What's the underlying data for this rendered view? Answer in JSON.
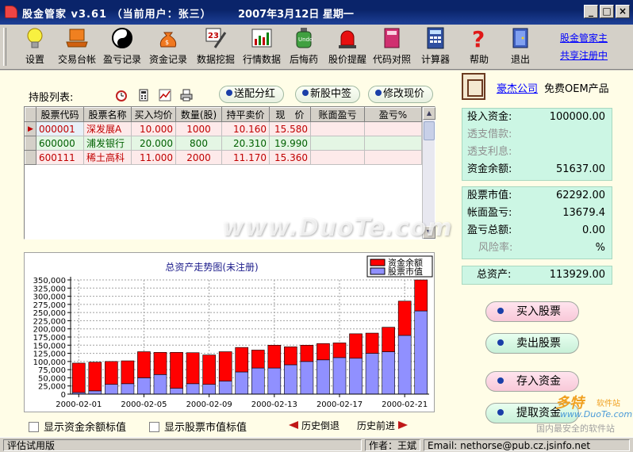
{
  "window": {
    "title": "股金管家 v3.61 （当前用户：张三）",
    "date": "2007年3月12日  星期一",
    "minimize": "_",
    "maximize": "□",
    "close": "×"
  },
  "toolbar": {
    "items": [
      {
        "label": "设置",
        "icon": "lightbulb-icon"
      },
      {
        "label": "交易台帐",
        "icon": "laptop-icon"
      },
      {
        "label": "盈亏记录",
        "icon": "yin-yang-icon"
      },
      {
        "label": "资金记录",
        "icon": "money-bag-icon"
      },
      {
        "label": "数据挖掘",
        "icon": "calendar-dig-icon"
      },
      {
        "label": "行情数据",
        "icon": "chart-icon"
      },
      {
        "label": "后悔药",
        "icon": "medicine-bottle-icon"
      },
      {
        "label": "股价提醒",
        "icon": "alarm-light-icon"
      },
      {
        "label": "代码对照",
        "icon": "book-icon"
      },
      {
        "label": "计算器",
        "icon": "calculator-icon"
      },
      {
        "label": "帮助",
        "icon": "question-icon"
      },
      {
        "label": "退出",
        "icon": "exit-door-icon"
      }
    ],
    "link1": "股金管家主",
    "link2": "共享注册中"
  },
  "holdings": {
    "label": "持股列表:",
    "btn_dividend": "送配分红",
    "btn_ipo": "新股中签",
    "btn_edit_price": "修改现价",
    "columns": [
      "股票代码",
      "股票名称",
      "买入均价",
      "数量(股)",
      "持平卖价",
      "现　价",
      "账面盈亏",
      "盈亏%"
    ],
    "rows": [
      {
        "code": "000001",
        "name": "深发展A",
        "buy": "10.000",
        "qty": "1000",
        "breakeven": "10.160",
        "price": "15.580",
        "pl": "",
        "plpct": ""
      },
      {
        "code": "600000",
        "name": "浦发银行",
        "buy": "20.000",
        "qty": "800",
        "breakeven": "20.310",
        "price": "19.990",
        "pl": "",
        "plpct": ""
      },
      {
        "code": "600111",
        "name": "稀土高科",
        "buy": "11.000",
        "qty": "2000",
        "breakeven": "11.170",
        "price": "15.360",
        "pl": "",
        "plpct": ""
      }
    ]
  },
  "chart_data": {
    "type": "bar",
    "stacked": true,
    "title": "总资产走势图(未注册)",
    "legend_position": "top-right",
    "ylim": [
      0,
      350000
    ],
    "yticks": [
      "0",
      "25,000",
      "50,000",
      "75,000",
      "100,000",
      "125,000",
      "150,000",
      "175,000",
      "200,000",
      "225,000",
      "250,000",
      "275,000",
      "300,000",
      "325,000",
      "350,000"
    ],
    "xtick_labels": [
      "2000-02-01",
      "2000-02-05",
      "2000-02-09",
      "2000-02-13",
      "2000-02-17",
      "2000-02-21"
    ],
    "xtick_index": [
      0,
      4,
      8,
      12,
      16,
      20
    ],
    "categories": [
      "2000-02-01",
      "2000-02-02",
      "2000-02-03",
      "2000-02-04",
      "2000-02-05",
      "2000-02-06",
      "2000-02-07",
      "2000-02-08",
      "2000-02-09",
      "2000-02-10",
      "2000-02-11",
      "2000-02-12",
      "2000-02-13",
      "2000-02-14",
      "2000-02-15",
      "2000-02-16",
      "2000-02-17",
      "2000-02-18",
      "2000-02-19",
      "2000-02-20",
      "2000-02-21",
      "2000-02-22"
    ],
    "series": [
      {
        "name": "资金余额",
        "color": "#ff0000",
        "values": [
          90000,
          88000,
          70000,
          70000,
          80000,
          68000,
          110000,
          95000,
          90000,
          90000,
          75000,
          55000,
          70000,
          55000,
          50000,
          50000,
          45000,
          75000,
          62000,
          75000,
          105000,
          95000
        ]
      },
      {
        "name": "股票市值",
        "color": "#9090ff",
        "values": [
          5000,
          10000,
          30000,
          32000,
          50000,
          60000,
          18000,
          32000,
          30000,
          40000,
          68000,
          80000,
          80000,
          90000,
          100000,
          105000,
          112000,
          110000,
          125000,
          130000,
          180000,
          255000
        ]
      }
    ]
  },
  "checks": {
    "show_cash_label": "显示资金余额标值",
    "show_mv_label": "显示股票市值标值"
  },
  "history": {
    "back": "历史倒退",
    "forward": "历史前进"
  },
  "company": {
    "link": "豪杰公司",
    "text": "免费OEM产品"
  },
  "funds": {
    "invested_label": "投入资金:",
    "invested_value": "100000.00",
    "overdraft_loan_label": "透支借款:",
    "overdraft_interest_label": "透支利息:",
    "balance_label": "资金余额:",
    "balance_value": "51637.00"
  },
  "market": {
    "mv_label": "股票市值:",
    "mv_value": "62292.00",
    "book_pl_label": "帐面盈亏:",
    "book_pl_value": "13679.4",
    "total_pl_label": "盈亏总额:",
    "total_pl_value": "0.00",
    "risk_label": "风险率:",
    "risk_value": "%"
  },
  "total": {
    "label": "总资产:",
    "value": "113929.00"
  },
  "actions": {
    "buy": "买入股票",
    "sell": "卖出股票",
    "deposit": "存入资金",
    "withdraw": "提取资金"
  },
  "status": {
    "edition": "评估试用版",
    "author": "作者：王斌",
    "email": "Email: nethorse@pub.cz.jsinfo.net"
  },
  "watermark": {
    "site": "www.DuoTe.com",
    "logo1": "多特",
    "logo2": "软件站",
    "logo3": "www.DuoTe.com",
    "logo4": "国内最安全的软件站"
  }
}
